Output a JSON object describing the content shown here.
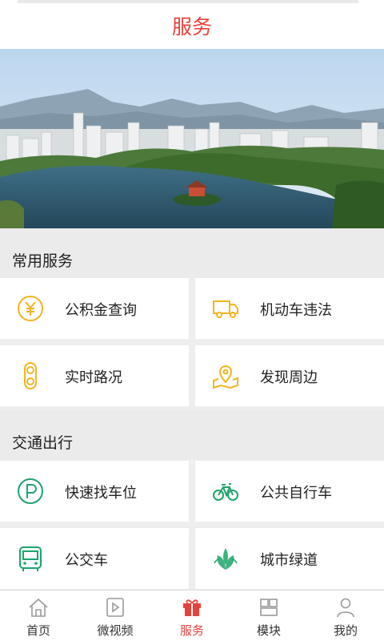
{
  "header": {
    "title": "服务"
  },
  "banner": {
    "pager_dots": 1,
    "active_index": 0
  },
  "sections": [
    {
      "title": "常用服务",
      "items": [
        {
          "label": "公积金查询",
          "icon": "yuan-coin-icon",
          "color": "#f5b41e"
        },
        {
          "label": "机动车违法",
          "icon": "truck-icon",
          "color": "#f5b41e"
        },
        {
          "label": "实时路况",
          "icon": "traffic-light-icon",
          "color": "#f5b41e"
        },
        {
          "label": "发现周边",
          "icon": "map-pin-icon",
          "color": "#f5b41e"
        }
      ]
    },
    {
      "title": "交通出行",
      "items": [
        {
          "label": "快速找车位",
          "icon": "parking-icon",
          "color": "#1ea46b"
        },
        {
          "label": "公共自行车",
          "icon": "bicycle-icon",
          "color": "#1ea46b"
        },
        {
          "label": "公交车",
          "icon": "bus-icon",
          "color": "#1ea46b"
        },
        {
          "label": "城市绿道",
          "icon": "leaves-icon",
          "color": "#1ea46b"
        }
      ]
    }
  ],
  "tabbar": {
    "active": "服务",
    "items": [
      {
        "label": "首页",
        "icon": "home-icon"
      },
      {
        "label": "微视频",
        "icon": "video-icon"
      },
      {
        "label": "服务",
        "icon": "gift-icon"
      },
      {
        "label": "模块",
        "icon": "modules-icon"
      },
      {
        "label": "我的",
        "icon": "user-icon"
      }
    ]
  },
  "colors": {
    "accent": "#e8413c",
    "orange": "#f5b41e",
    "green": "#1ea46b"
  }
}
